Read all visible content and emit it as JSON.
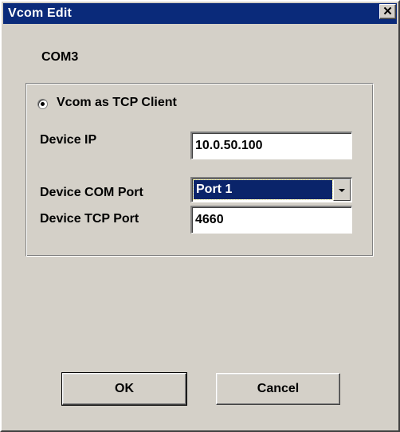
{
  "window": {
    "title": "Vcom Edit",
    "close_glyph": "✕"
  },
  "port_name": "COM3",
  "mode": {
    "label": "Vcom as TCP Client",
    "selected": true
  },
  "device_ip": {
    "label": "Device IP",
    "value": "10.0.50.100"
  },
  "device_com_port": {
    "label": "Device COM Port",
    "value": "Port 1"
  },
  "device_tcp_port": {
    "label": "Device TCP Port",
    "value": "4660"
  },
  "buttons": {
    "ok": "OK",
    "cancel": "Cancel"
  },
  "colors": {
    "titlebar": "#0a2a7a",
    "selection": "#0a246a",
    "face": "#d4d0c8"
  }
}
